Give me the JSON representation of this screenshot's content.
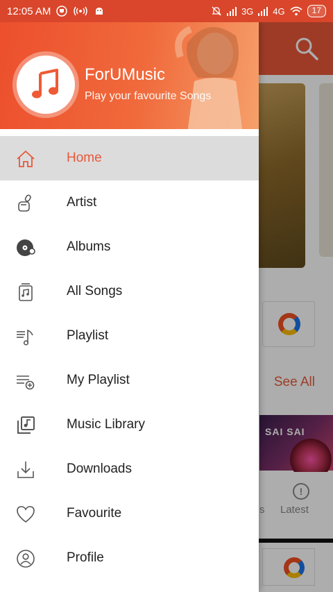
{
  "statusbar": {
    "time": "12:05 AM",
    "network": "3G",
    "network2": "4G",
    "battery": "17"
  },
  "background": {
    "see_all": "See All",
    "album_text": "SAI SAI",
    "tab_partial": "s",
    "tab_latest": "Latest"
  },
  "drawer": {
    "app_name": "ForUMusic",
    "tagline": "Play your favourite Songs",
    "items": [
      {
        "label": "Home",
        "icon": "home-icon",
        "active": true
      },
      {
        "label": "Artist",
        "icon": "artist-icon"
      },
      {
        "label": "Albums",
        "icon": "album-disc-icon"
      },
      {
        "label": "All Songs",
        "icon": "all-songs-icon"
      },
      {
        "label": "Playlist",
        "icon": "playlist-icon"
      },
      {
        "label": "My Playlist",
        "icon": "my-playlist-icon"
      },
      {
        "label": "Music Library",
        "icon": "music-library-icon"
      },
      {
        "label": "Downloads",
        "icon": "download-icon"
      },
      {
        "label": "Favourite",
        "icon": "heart-icon"
      },
      {
        "label": "Profile",
        "icon": "profile-icon"
      }
    ]
  },
  "colors": {
    "accent": "#e8583a",
    "statusbar": "#d9462b",
    "active_row": "#dcdcdc"
  }
}
